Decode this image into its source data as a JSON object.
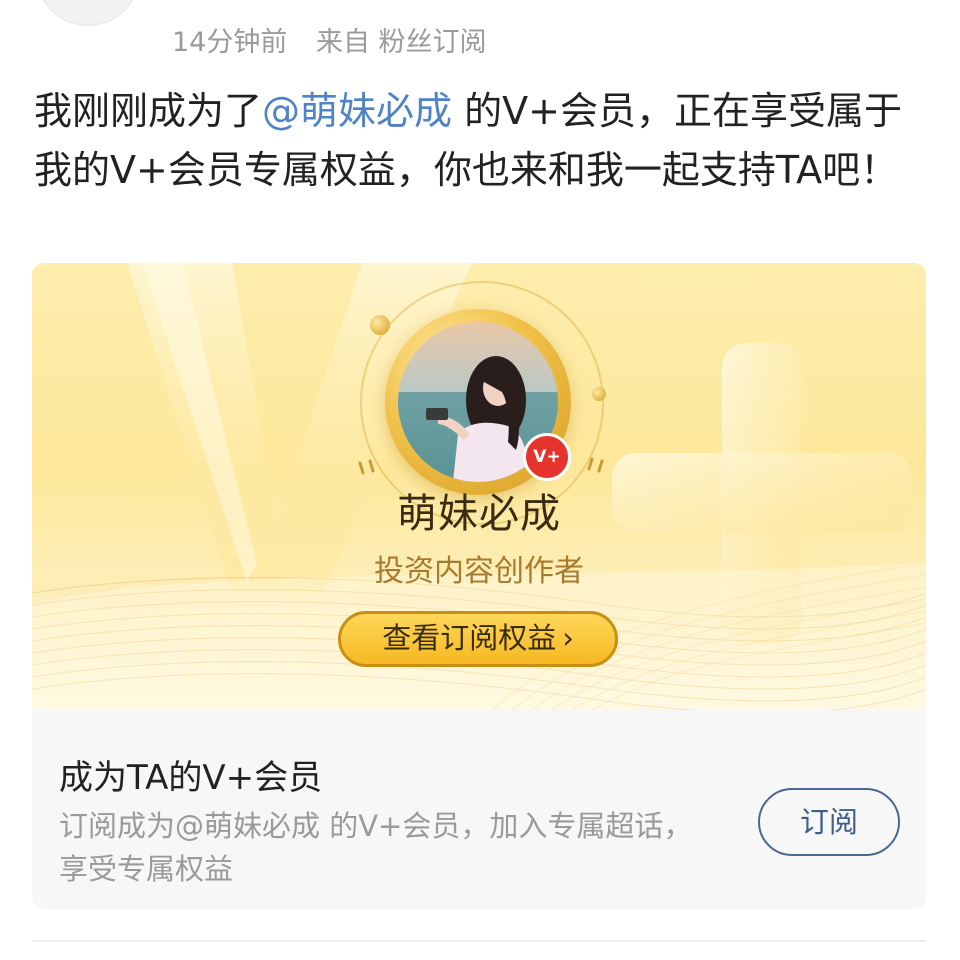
{
  "post": {
    "meta": {
      "time": "14分钟前",
      "source": "来自 粉丝订阅"
    },
    "text_before": "我刚刚成为了",
    "mention": "@萌妹必成",
    "text_after": " 的V+会员，正在享受属于我的V+会员专属权益，你也来和我一起支持TA吧！"
  },
  "card": {
    "badge_icon": "v-plus-badge",
    "creator_name": "萌妹必成",
    "creator_role": "投资内容创作者",
    "benefits_button": "查看订阅权益",
    "benefits_chevron": "›",
    "info_title": "成为TA的V+会员",
    "info_desc": "订阅成为@萌妹必成 的V+会员，加入专属超话，享受专属权益",
    "subscribe_button": "订阅"
  },
  "colors": {
    "mention": "#4f83c6",
    "gold": "#f5b922",
    "badge_red": "#e5342c",
    "subscribe_border": "#48688e"
  }
}
